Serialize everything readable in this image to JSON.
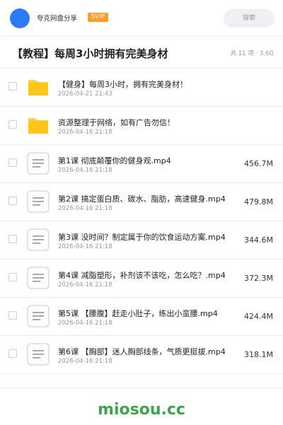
{
  "header": {
    "app_name": "夸克网盘分享",
    "badge": "SVIP",
    "search_placeholder": "搜索",
    "avatar_color": "#2a7cf6"
  },
  "folder": {
    "title": "【教程】每周3小时拥有完美身材",
    "meta": "共 11 项 · 3.6G"
  },
  "files": [
    {
      "type": "folder",
      "name": "【健身】每周3小时，拥有完美身材！",
      "date": "2026-04-21 21:43",
      "size": ""
    },
    {
      "type": "folder",
      "name": "资源整理于网络，如有广告勿信！",
      "date": "2026-04-16 21:18",
      "size": ""
    },
    {
      "type": "video",
      "name": "第1课 彻底颠覆你的健身观.mp4",
      "date": "2026-04-16 21:18",
      "size": "456.7M"
    },
    {
      "type": "video",
      "name": "第2课 搞定蛋白质、碳水、脂肪，高速健身.mp4",
      "date": "2026-04-16 21:18",
      "size": "479.8M"
    },
    {
      "type": "video",
      "name": "第3课 没时间？制定属于你的饮食运动方案.mp4",
      "date": "2026-04-16 21:18",
      "size": "344.6M"
    },
    {
      "type": "video",
      "name": "第4课 减脂塑形，补剂该不该吃，怎么吃？.mp4",
      "date": "2026-04-16 21:18",
      "size": "372.3M"
    },
    {
      "type": "video",
      "name": "第5课 【腰腹】赶走小肚子，练出小蛮腰.mp4",
      "date": "2026-04-16 21:18",
      "size": "424.4M"
    },
    {
      "type": "video",
      "name": "第6课 【胸部】迷人胸部线条，气质更挺拔.mp4",
      "date": "2026-04-16 21:18",
      "size": "318.1M"
    }
  ],
  "watermark": "miosou.cc",
  "colors": {
    "folder": "#ffc51a",
    "svip": "#ff9d2e",
    "watermark": "#3fa34d"
  }
}
